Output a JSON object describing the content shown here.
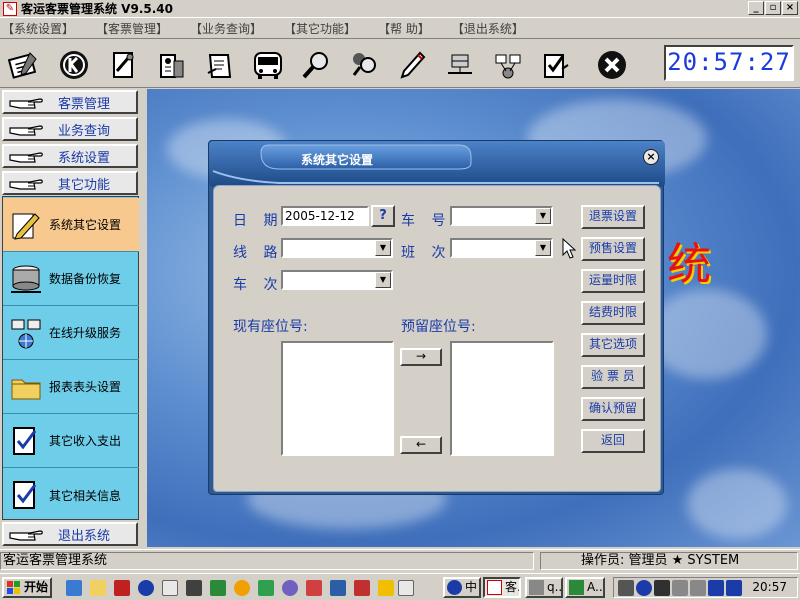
{
  "window": {
    "title": "客运客票管理系统 V9.5.40",
    "app_icon": "ticket-app-icon",
    "controls": [
      "_",
      "▫",
      "×"
    ]
  },
  "menu": [
    "【系统设置】",
    "【客票管理】",
    "【业务查询】",
    "【其它功能】",
    "【帮  助】",
    "【退出系统】"
  ],
  "toolbar": {
    "icons": [
      "tickets-icon",
      "k-circle-icon",
      "tools-icon",
      "station-icon",
      "form-icon",
      "bus-icon",
      "search-icon",
      "users-search-icon",
      "pen-icon",
      "server-icon",
      "network-icon",
      "checkbox-icon",
      "exit-circle-icon"
    ],
    "clock": "20:57:27"
  },
  "nav": {
    "top_buttons": [
      "客票管理",
      "业务查询",
      "系统设置",
      "其它功能"
    ],
    "bottom_button": "退出系统",
    "sub_items": [
      {
        "label": "系统其它设置",
        "icon": "pen-notepad-icon",
        "active": true
      },
      {
        "label": "数据备份恢复",
        "icon": "database-icon",
        "active": false
      },
      {
        "label": "在线升级服务",
        "icon": "network-globe-icon",
        "active": false
      },
      {
        "label": "报表表头设置",
        "icon": "folder-icon",
        "active": false
      },
      {
        "label": "其它收入支出",
        "icon": "checklist-icon",
        "active": false
      },
      {
        "label": "其它相关信息",
        "icon": "checklist-icon",
        "active": false
      }
    ]
  },
  "background_text": "统",
  "dialog": {
    "title": "系统其它设置",
    "close": "×",
    "labels": {
      "date": "日 期",
      "plate": "车 号",
      "route": "线 路",
      "shift": "班 次",
      "trip": "车 次",
      "current_seats": "现有座位号:",
      "reserved_seats": "预留座位号:"
    },
    "date_value": "2005-12-12",
    "help_button": "?",
    "arrow_right": "→",
    "arrow_left": "←",
    "side_buttons": [
      "退票设置",
      "预售设置",
      "运量时限",
      "结费时限",
      "其它选项",
      "验 票 员",
      "确认预留",
      "返回"
    ]
  },
  "status": {
    "left": "客运客票管理系统",
    "right": "操作员: 管理员 ★ SYSTEM"
  },
  "taskbar": {
    "start": "开始",
    "tasks": [
      "q..",
      "中",
      "客...",
      "q...",
      "A..."
    ],
    "time": "20:57"
  },
  "colors": {
    "accent_blue": "#1a3ba8",
    "clock_blue": "#1a3bd8",
    "nav_subpanel": "#6ecde8",
    "active_item": "#f7c98e",
    "dialog_frame": "#2d5a92",
    "bg_red_char": "#e81010"
  }
}
